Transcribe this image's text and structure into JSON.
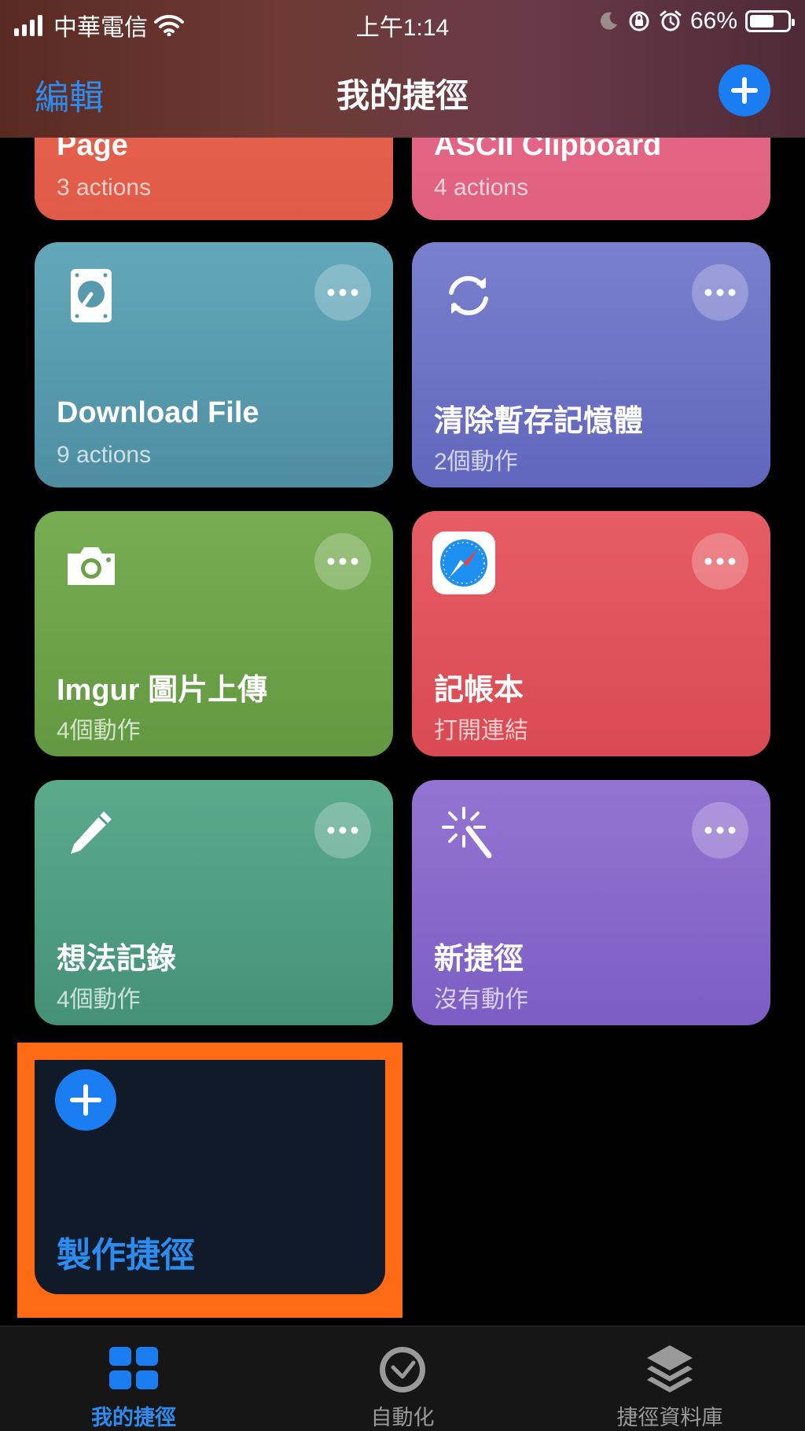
{
  "status_bar": {
    "carrier": "中華電信",
    "time": "上午1:14",
    "battery": "66%",
    "battery_level": 0.66
  },
  "nav": {
    "edit_label": "編輯",
    "title": "我的捷徑",
    "add_icon": "plus-icon"
  },
  "cards": [
    {
      "name": "Page",
      "sub": "3 actions",
      "color": "#e65f4b"
    },
    {
      "name": "ASCII Clipboard",
      "sub": "4 actions",
      "color": "#e6668a"
    },
    {
      "name": "Download File",
      "sub": "9 actions",
      "color": "#579aae",
      "icon": "hard-drive-icon"
    },
    {
      "name": "清除暫存記憶體",
      "sub": "2個動作",
      "color": "#6b72c5",
      "icon": "sync-arrows-icon"
    },
    {
      "name": "Imgur 圖片上傳",
      "sub": "4個動作",
      "color": "#6ca24a",
      "icon": "camera-icon"
    },
    {
      "name": "記帳本",
      "sub": "打開連結",
      "color": "#df535b",
      "icon": "safari-compass-icon"
    },
    {
      "name": "想法記錄",
      "sub": "4個動作",
      "color": "#4f9d83",
      "icon": "pencil-icon"
    },
    {
      "name": "新捷徑",
      "sub": "沒有動作",
      "color": "#8768ca",
      "icon": "magic-wand-icon"
    }
  ],
  "create": {
    "label": "製作捷徑",
    "highlight_color": "#ff6a14"
  },
  "tabs": [
    {
      "label": "我的捷徑",
      "icon": "grid-icon",
      "active": true
    },
    {
      "label": "自動化",
      "icon": "clock-check-icon",
      "active": false
    },
    {
      "label": "捷徑資料庫",
      "icon": "layers-icon",
      "active": false
    }
  ],
  "accent": "#1a7ef2"
}
